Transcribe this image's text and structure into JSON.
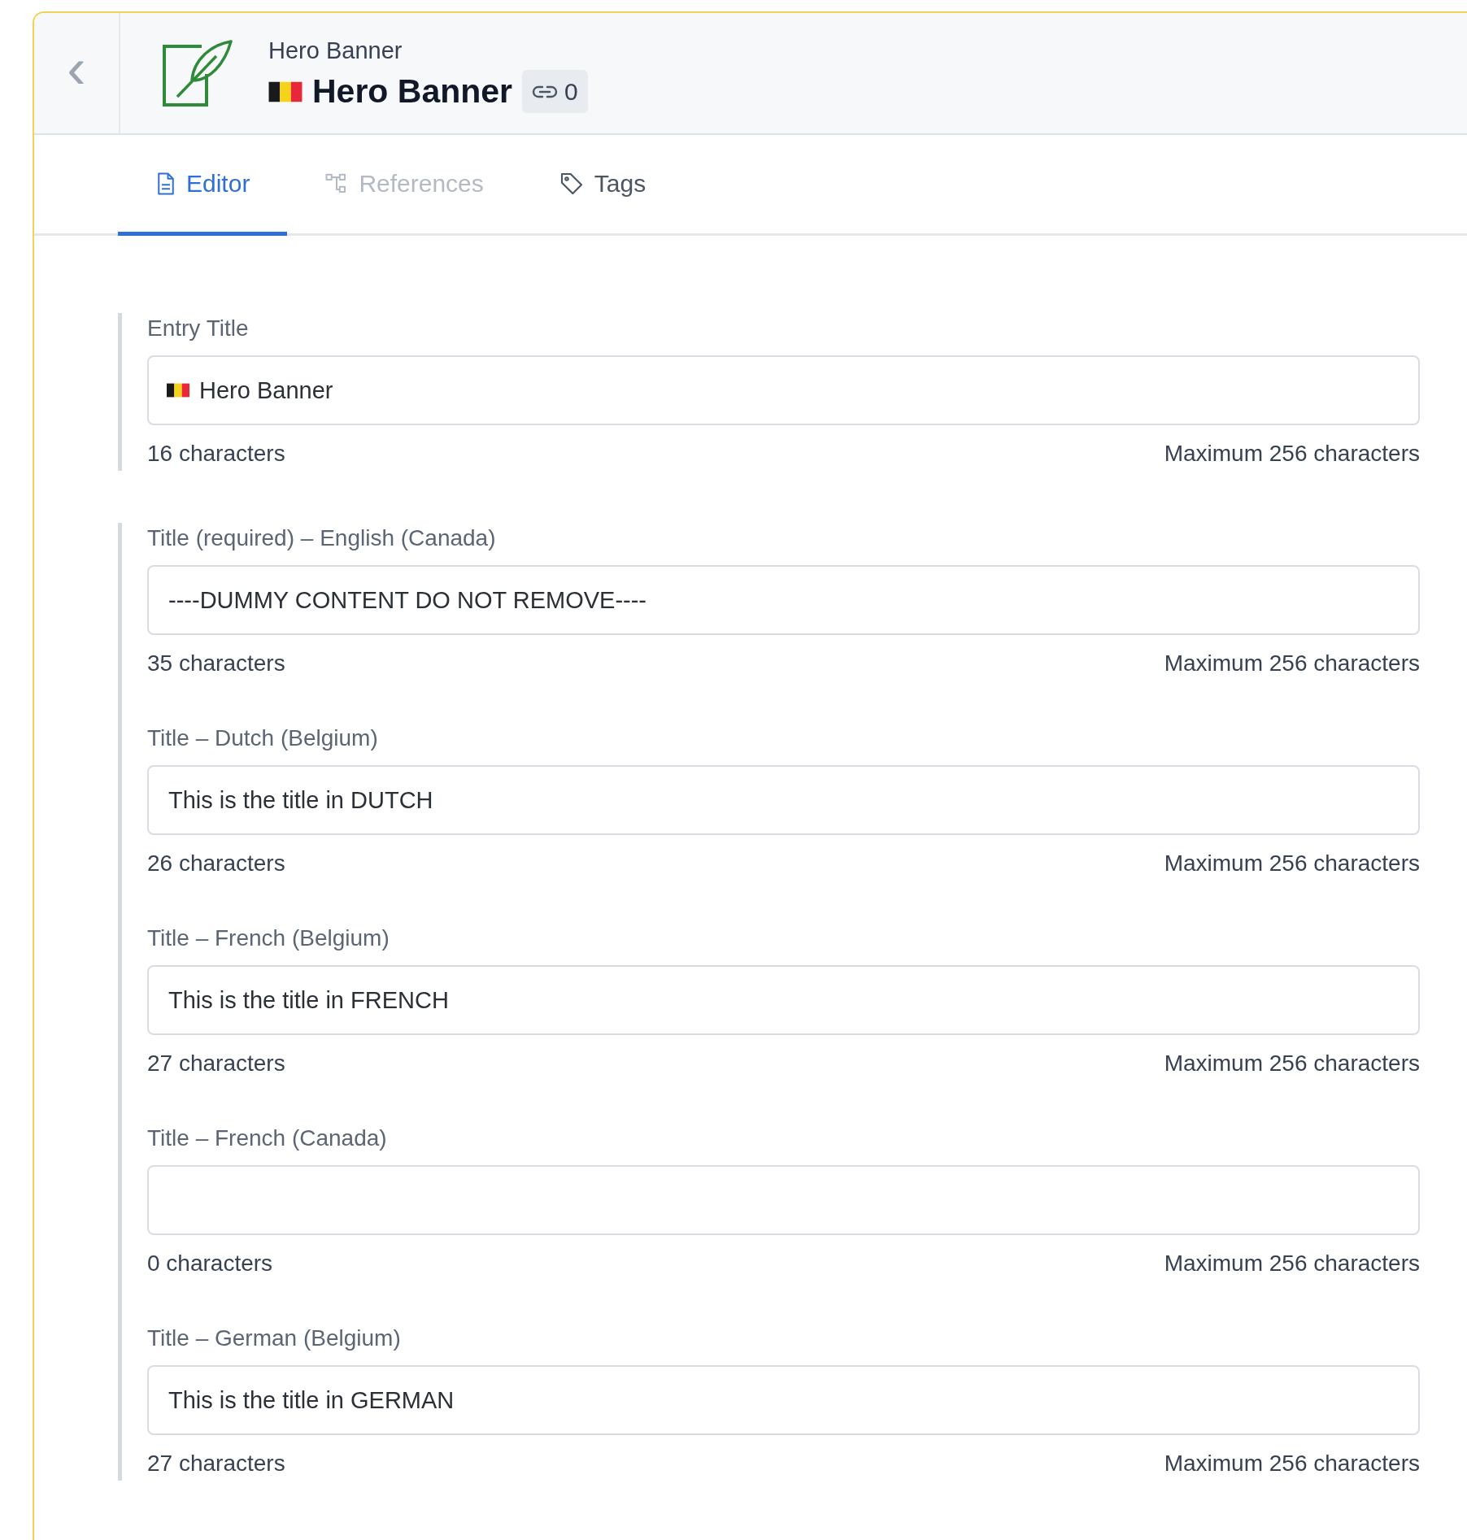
{
  "header": {
    "back_label": "‹",
    "subtitle": "Hero Banner",
    "title": "Hero Banner",
    "link_count": "0"
  },
  "tabs": [
    {
      "label": "Editor",
      "selected": true,
      "disabled": false
    },
    {
      "label": "References",
      "selected": false,
      "disabled": true
    },
    {
      "label": "Tags",
      "selected": false,
      "disabled": false
    }
  ],
  "groups": [
    {
      "fields": [
        {
          "kind": "entry_title",
          "label": "Entry Title",
          "value": "Hero Banner",
          "count": "16 characters",
          "max": "Maximum 256 characters"
        }
      ]
    },
    {
      "fields": [
        {
          "kind": "translation",
          "label": "Title (required) – English (Canada)",
          "value": "----DUMMY CONTENT DO NOT REMOVE----",
          "count": "35 characters",
          "max": "Maximum 256 characters"
        },
        {
          "kind": "translation",
          "label": "Title – Dutch (Belgium)",
          "value": "This is the title in DUTCH",
          "count": "26 characters",
          "max": "Maximum 256 characters"
        },
        {
          "kind": "translation",
          "label": "Title – French (Belgium)",
          "value": "This is the title in FRENCH",
          "count": "27 characters",
          "max": "Maximum 256 characters"
        },
        {
          "kind": "translation",
          "label": "Title – French (Canada)",
          "count": "0 characters",
          "max": "Maximum 256 characters"
        },
        {
          "kind": "translation",
          "label": "Title – German (Belgium)",
          "value": "This is the title in GERMAN",
          "count": "27 characters",
          "max": "Maximum 256 characters"
        }
      ]
    }
  ]
}
